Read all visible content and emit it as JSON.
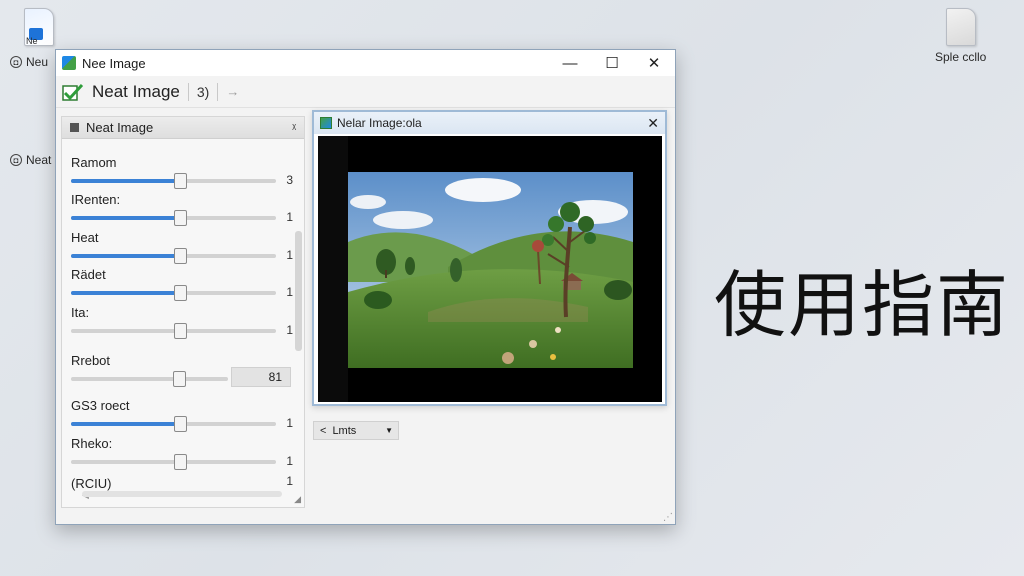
{
  "desktop": {
    "icons": [
      {
        "label": "Ne",
        "icon": "blue-document-icon"
      },
      {
        "label": "Sple ccllo",
        "icon": "blank-file-icon"
      }
    ],
    "side_labels": [
      "Neu",
      "Neat"
    ],
    "cjk_text": "使用指南"
  },
  "window": {
    "title": "Nee Image",
    "controls": {
      "minimize": "—",
      "maximize": "☐",
      "close": "✕"
    },
    "toolbar": {
      "title": "Neat Image",
      "count": "3)",
      "arrow": "→"
    }
  },
  "panel": {
    "title": "Neat Image",
    "pin": "ᵡ",
    "sliders": [
      {
        "label": "Ramom",
        "value": "3",
        "level": 0.53,
        "filled": true
      },
      {
        "label": "IRenten:",
        "value": "1",
        "level": 0.53,
        "filled": true
      },
      {
        "label": "Heat",
        "value": "1",
        "level": 0.53,
        "filled": true
      },
      {
        "label": "Rädet",
        "value": "1",
        "level": 0.53,
        "filled": true
      },
      {
        "label": "Ita:",
        "value": "1",
        "level": 0.53,
        "filled": false
      },
      {
        "label": "Rrebot",
        "value": "81",
        "level": 0.7,
        "filled": false,
        "boxed": true
      },
      {
        "label": "GS3 roect",
        "value": "1",
        "level": 0.53,
        "filled": true
      },
      {
        "label": "Rheko:",
        "value": "1",
        "level": 0.53,
        "filled": false
      },
      {
        "label": "(RCIU)",
        "value": "1",
        "level": null,
        "filled": false
      }
    ]
  },
  "image_window": {
    "title": "Nelar Image:ola",
    "close": "✕"
  },
  "dropdown": {
    "arrow": "<",
    "value": "Lmts",
    "caret": "▼"
  }
}
